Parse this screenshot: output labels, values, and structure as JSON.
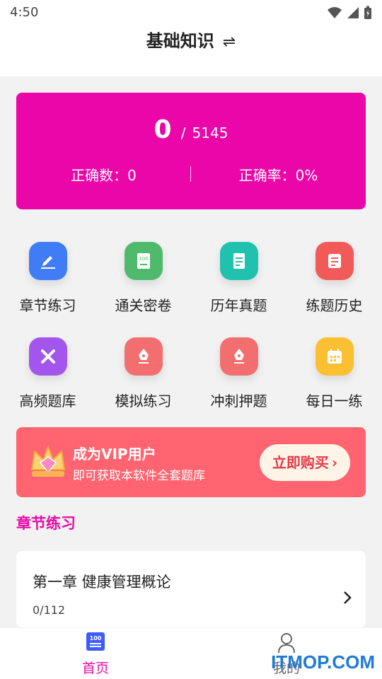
{
  "status_bar": {
    "time": "4:50"
  },
  "header": {
    "title": "基础知识",
    "swap_symbol": "⇌"
  },
  "score": {
    "correct_count_big": "0",
    "separator": "/",
    "total": "5145",
    "correct_count_label": "正确数：0",
    "accuracy_label": "正确率：0%"
  },
  "grid": [
    {
      "label": "章节练习",
      "icon": "pencil-note-icon",
      "color": "#3f7cf5"
    },
    {
      "label": "通关密卷",
      "icon": "score-100-icon",
      "color": "#4fba6c"
    },
    {
      "label": "历年真题",
      "icon": "document-icon",
      "color": "#21c1b0"
    },
    {
      "label": "练题历史",
      "icon": "notebook-icon",
      "color": "#f25a5a"
    },
    {
      "label": "高频题库",
      "icon": "pencil-ruler-icon",
      "color": "#a256ee"
    },
    {
      "label": "模拟练习",
      "icon": "pen-icon",
      "color": "#f36f6f"
    },
    {
      "label": "冲刺押题",
      "icon": "pen-icon",
      "color": "#f36f6f"
    },
    {
      "label": "每日一练",
      "icon": "calendar-icon",
      "color": "#fbbf32"
    }
  ],
  "vip": {
    "title": "成为VIP用户",
    "subtitle": "即可获取本软件全套题库",
    "button": "立即购买"
  },
  "section": {
    "title": "章节练习"
  },
  "chapters": [
    {
      "name": "第一章 健康管理概论",
      "progress": "0/112"
    }
  ],
  "tabs": [
    {
      "label": "首页",
      "active": true,
      "icon": "score-100-icon"
    },
    {
      "label": "我的",
      "active": false,
      "icon": "person-icon"
    }
  ],
  "watermark": "ITMOP.COM",
  "colors": {
    "accent": "#e90aa6",
    "score_card": "#ea06a8",
    "vip_banner": "#ff6470"
  }
}
